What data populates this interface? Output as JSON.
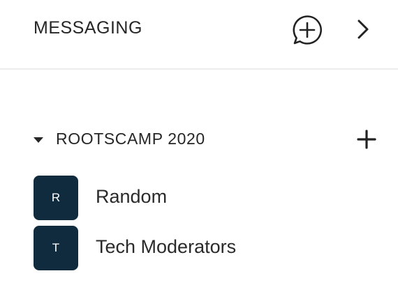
{
  "header": {
    "title": "MESSAGING",
    "new_message_icon": "chat-bubble-plus-icon",
    "expand_icon": "chevron-right-icon"
  },
  "group": {
    "title": "ROOTSCAMP 2020",
    "collapse_icon": "caret-down-icon",
    "add_icon": "plus-icon"
  },
  "channels": [
    {
      "initial": "R",
      "name": "Random"
    },
    {
      "initial": "T",
      "name": "Tech Moderators"
    }
  ],
  "colors": {
    "avatar_bg": "#0f2b3d",
    "divider": "#ececec"
  }
}
